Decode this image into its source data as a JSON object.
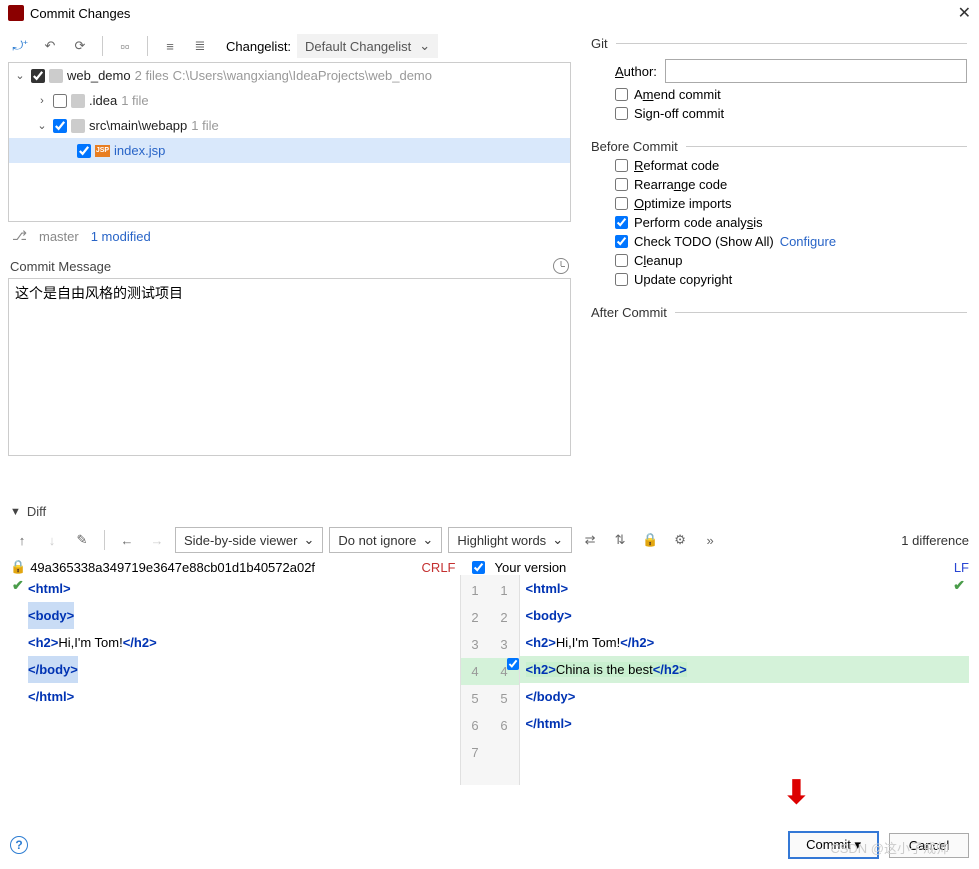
{
  "title": "Commit Changes",
  "toolbar": {
    "changelist_label": "Changelist:",
    "changelist_value": "Default Changelist"
  },
  "tree": {
    "root": {
      "name": "web_demo",
      "meta1": "2 files",
      "meta2": "C:\\Users\\wangxiang\\IdeaProjects\\web_demo"
    },
    "idea": {
      "name": ".idea",
      "meta": "1 file"
    },
    "webapp": {
      "name": "src\\main\\webapp",
      "meta": "1 file"
    },
    "file": {
      "name": "index.jsp",
      "icon_label": "JSP"
    }
  },
  "branch": {
    "name": "master",
    "modified": "1 modified"
  },
  "commit_msg": {
    "label": "Commit Message",
    "value": "这个是自由风格的测试项目"
  },
  "git": {
    "legend": "Git",
    "author_label": "Author:",
    "amend": "Amend commit",
    "signoff": "Sign-off commit"
  },
  "before": {
    "legend": "Before Commit",
    "reformat": "Reformat code",
    "rearrange": "Rearrange code",
    "optimize": "Optimize imports",
    "analysis": "Perform code analysis",
    "todo": "Check TODO (Show All)",
    "configure": "Configure",
    "cleanup": "Cleanup",
    "copyright": "Update copyright"
  },
  "after": {
    "legend": "After Commit"
  },
  "diff": {
    "label": "Diff",
    "viewer": "Side-by-side viewer",
    "ignore": "Do not ignore",
    "highlight": "Highlight words",
    "count": "1 difference",
    "left_file": "49a365338a349719e3647e88cb01d1b40572a02f",
    "left_enc": "CRLF",
    "right_file": "Your version",
    "right_enc": "LF",
    "lines": {
      "n1": "1",
      "n2": "2",
      "n3": "3",
      "n4": "4",
      "n5": "5",
      "n6": "6",
      "n7": "7"
    },
    "left_code": {
      "l3": "Hi,I'm Tom!"
    },
    "right_code": {
      "l3": "Hi,I'm Tom!",
      "l4": "China is the best"
    }
  },
  "buttons": {
    "commit": "Commit",
    "cancel": "Cancel"
  },
  "watermark": "CSDN @这小子戒帅"
}
